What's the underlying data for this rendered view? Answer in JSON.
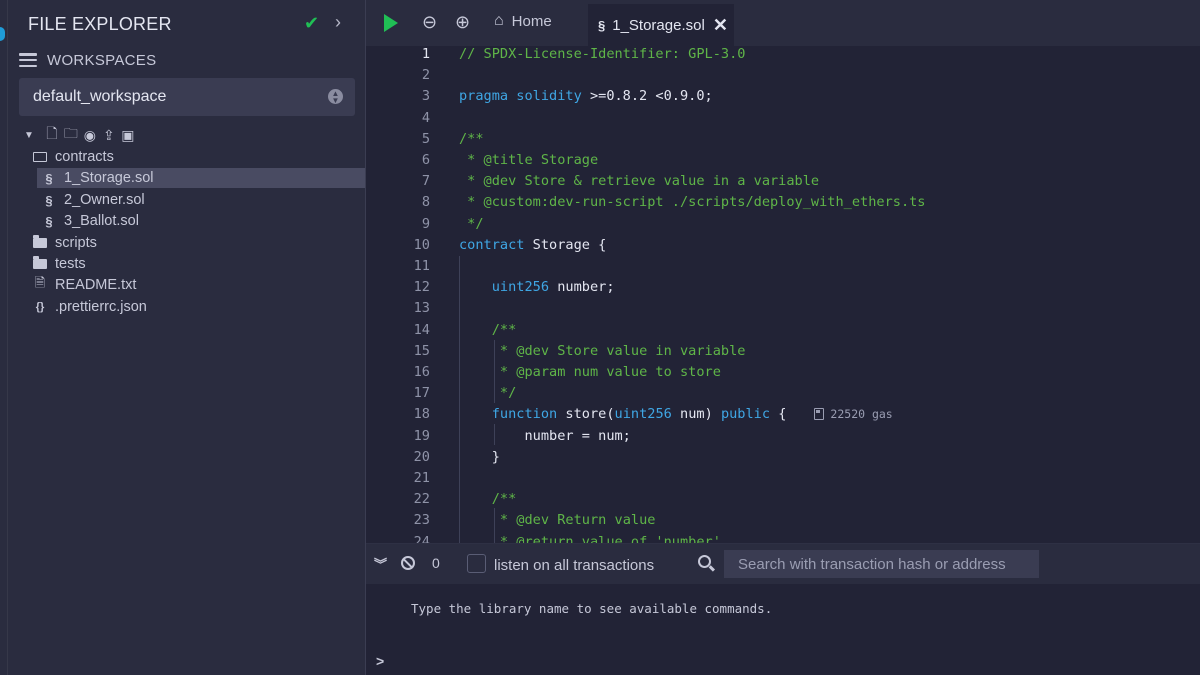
{
  "explorer": {
    "title": "FILE EXPLORER",
    "workspaces_label": "WORKSPACES",
    "workspace_selected": "default_workspace",
    "tree": [
      {
        "label": "contracts",
        "type": "folder-open"
      },
      {
        "label": "1_Storage.sol",
        "type": "sol",
        "selected": true
      },
      {
        "label": "2_Owner.sol",
        "type": "sol"
      },
      {
        "label": "3_Ballot.sol",
        "type": "sol"
      },
      {
        "label": "scripts",
        "type": "folder"
      },
      {
        "label": "tests",
        "type": "folder"
      },
      {
        "label": "README.txt",
        "type": "file"
      },
      {
        "label": ".prettierrc.json",
        "type": "json"
      }
    ]
  },
  "topbar": {
    "home_label": "Home",
    "active_tab": "1_Storage.sol"
  },
  "editor": {
    "active_line": 1,
    "gas_estimate": "22520 gas",
    "lines": [
      {
        "n": "1",
        "parts": [
          [
            "c-cm",
            "// SPDX-License-Identifier: GPL-3.0"
          ]
        ]
      },
      {
        "n": "2",
        "parts": []
      },
      {
        "n": "3",
        "parts": [
          [
            "c-kw",
            "pragma solidity"
          ],
          [
            "c-tx",
            " >=0.8.2 <0.9.0;"
          ]
        ]
      },
      {
        "n": "4",
        "parts": []
      },
      {
        "n": "5",
        "parts": [
          [
            "c-cm",
            "/**"
          ]
        ]
      },
      {
        "n": "6",
        "parts": [
          [
            "c-cm",
            " * @title Storage"
          ]
        ]
      },
      {
        "n": "7",
        "parts": [
          [
            "c-cm",
            " * @dev Store & retrieve value in a variable"
          ]
        ]
      },
      {
        "n": "8",
        "parts": [
          [
            "c-cm",
            " * @custom:dev-run-script ./scripts/deploy_with_ethers.ts"
          ]
        ]
      },
      {
        "n": "9",
        "parts": [
          [
            "c-cm",
            " */"
          ]
        ]
      },
      {
        "n": "10",
        "parts": [
          [
            "c-kw",
            "contract"
          ],
          [
            "c-tx",
            " Storage {"
          ]
        ]
      },
      {
        "n": "11",
        "parts": []
      },
      {
        "n": "12",
        "parts": [
          [
            "c-tx",
            "    "
          ],
          [
            "c-kw",
            "uint256"
          ],
          [
            "c-tx",
            " number;"
          ]
        ]
      },
      {
        "n": "13",
        "parts": []
      },
      {
        "n": "14",
        "parts": [
          [
            "c-tx",
            "    "
          ],
          [
            "c-cm",
            "/**"
          ]
        ]
      },
      {
        "n": "15",
        "parts": [
          [
            "c-tx",
            "    "
          ],
          [
            "c-cm",
            " * @dev Store value in variable"
          ]
        ]
      },
      {
        "n": "16",
        "parts": [
          [
            "c-tx",
            "    "
          ],
          [
            "c-cm",
            " * @param num value to store"
          ]
        ]
      },
      {
        "n": "17",
        "parts": [
          [
            "c-tx",
            "    "
          ],
          [
            "c-cm",
            " */"
          ]
        ]
      },
      {
        "n": "18",
        "parts": [
          [
            "c-tx",
            "    "
          ],
          [
            "c-kw",
            "function"
          ],
          [
            "c-tx",
            " store("
          ],
          [
            "c-kw",
            "uint256"
          ],
          [
            "c-tx",
            " num) "
          ],
          [
            "c-kw",
            "public"
          ],
          [
            "c-tx",
            " {"
          ]
        ],
        "gas": true
      },
      {
        "n": "19",
        "parts": [
          [
            "c-tx",
            "        number = num;"
          ]
        ]
      },
      {
        "n": "20",
        "parts": [
          [
            "c-tx",
            "    }"
          ]
        ]
      },
      {
        "n": "21",
        "parts": []
      },
      {
        "n": "22",
        "parts": [
          [
            "c-tx",
            "    "
          ],
          [
            "c-cm",
            "/**"
          ]
        ]
      },
      {
        "n": "23",
        "parts": [
          [
            "c-tx",
            "    "
          ],
          [
            "c-cm",
            " * @dev Return value"
          ]
        ]
      },
      {
        "n": "24",
        "parts": [
          [
            "c-tx",
            "    "
          ],
          [
            "c-cm",
            " * @return value of 'number'"
          ]
        ]
      }
    ]
  },
  "terminal": {
    "pending_count": "0",
    "listen_label": "listen on all transactions",
    "search_placeholder": "Search with transaction hash or address",
    "message": "Type the library name to see available commands.",
    "prompt": ">"
  }
}
